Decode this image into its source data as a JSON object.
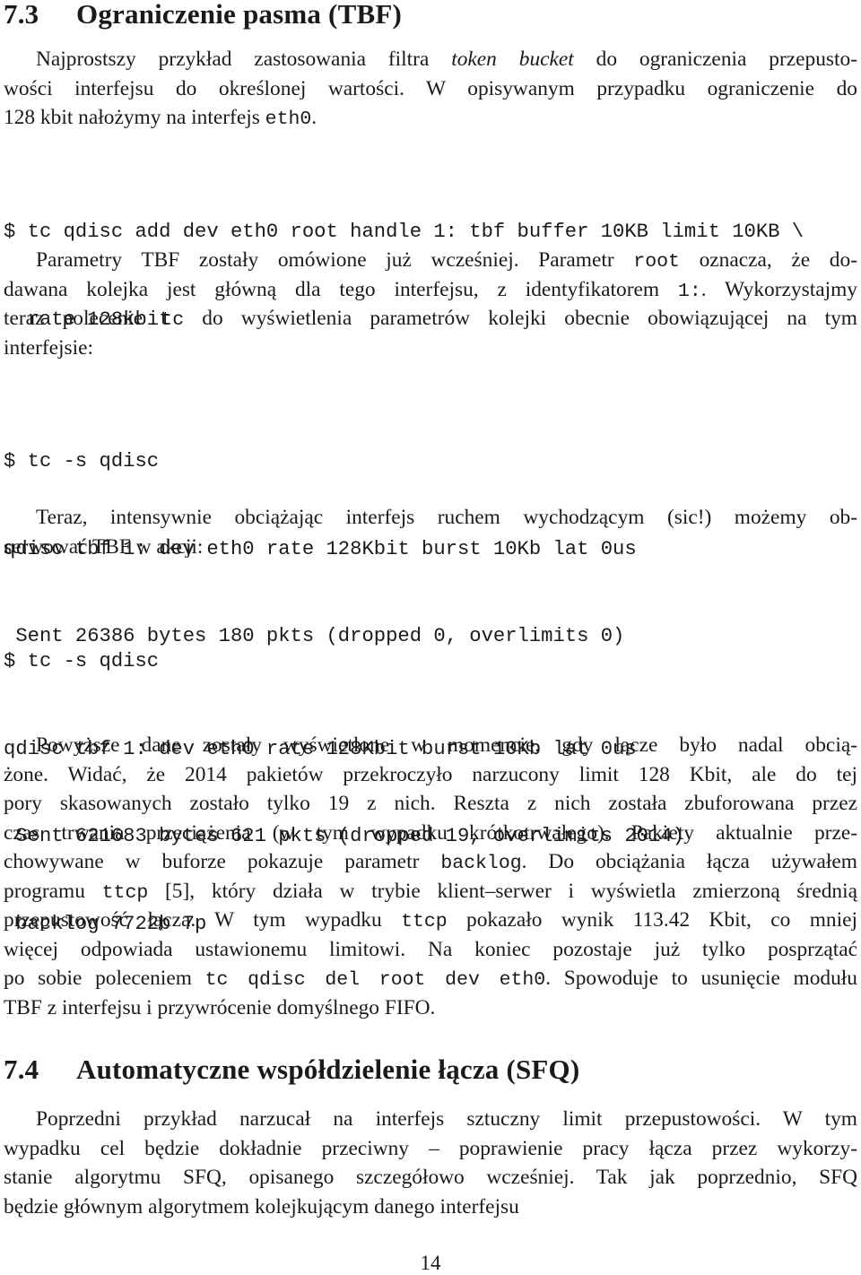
{
  "section_73": {
    "number": "7.3",
    "title": "Ograniczenie pasma (TBF)"
  },
  "p1": {
    "l1_a": "Najprostszy przykład zastosowania filtra ",
    "l1_em": "token bucket",
    "l1_b": " do ograniczenia przepusto-",
    "l2": "wości interfejsu do określonej wartości. W opisywanym przypadku ograniczenie do",
    "l3_a": "128 kbit nałożymy na interfejs ",
    "l3_code": "eth0",
    "l3_b": "."
  },
  "code1": {
    "lines": [
      "$ tc qdisc add dev eth0 root handle 1: tbf buffer 10KB limit 10KB \\",
      "  rate 128kbit"
    ]
  },
  "p2": {
    "l1_a": "Parametry TBF zostały omówione już wcześniej. Parametr ",
    "l1_code": "root",
    "l1_b": " oznacza, że do-",
    "l2_a": "dawana kolejka jest główną dla tego interfejsu, z identyfikatorem ",
    "l2_code": "1:",
    "l2_b": ". Wykorzystajmy",
    "l3_a": "teraz polecenie ",
    "l3_code": "tc",
    "l3_b": " do wyświetlenia parametrów kolejki obecnie obowiązującej na tym",
    "l4": "interfejsie:"
  },
  "code2": {
    "lines": [
      "$ tc -s qdisc",
      "qdisc tbf 1: dev eth0 rate 128Kbit burst 10Kb lat 0us",
      " Sent 26386 bytes 180 pkts (dropped 0, overlimits 0)"
    ]
  },
  "p3": {
    "l1": "Teraz, intensywnie obciążając interfejs ruchem wychodzącym (sic!) możemy ob-",
    "l2": "serwować TBF w akcji:"
  },
  "code3": {
    "lines": [
      "$ tc -s qdisc",
      "qdisc tbf 1: dev eth0 rate 128Kbit burst 10Kb lat 0us",
      " Sent 621683 bytes 621 pkts (dropped 19, overlimits 2014)",
      " backlog 7722b 7p"
    ]
  },
  "p4": {
    "l1": "Powyższe dane zostały wyświetlone w momencie, gdy łącze było nadal obcią-",
    "l2": "żone. Widać, że 2014 pakietów przekroczyło narzucony limit 128 Kbit, ale do tej",
    "l3": "pory skasowanych zostało tylko 19 z nich. Reszta z nich została zbuforowana przez",
    "l4": "czas trwania przeciążenia (w tym wypadku krótkotrwałego). Pakiety aktualnie prze-",
    "l5_a": "chowywane w buforze pokazuje parametr ",
    "l5_code": "backlog",
    "l5_b": ". Do obciążania łącza używałem",
    "l6_a": "programu ",
    "l6_code": "ttcp",
    "l6_b": " [5], który działa w trybie klient–serwer i wyświetla zmierzoną średnią",
    "l7_a": "przepustowość łącza. W tym wypadku ",
    "l7_code": "ttcp",
    "l7_b": " pokazało wynik 113.42 Kbit, co mniej",
    "l8": "więcej odpowiada ustawionemu limitowi. Na koniec pozostaje już tylko posprzątać",
    "l9_a": "po sobie poleceniem ",
    "l9_code": "tc qdisc del root dev eth0",
    "l9_b": ". Spowoduje to usunięcie modułu",
    "l10": "TBF z interfejsu i przywrócenie domyślnego FIFO."
  },
  "section_74": {
    "number": "7.4",
    "title": "Automatyczne współdzielenie łącza (SFQ)"
  },
  "p5": {
    "l1": "Poprzedni przykład narzucał na interfejs sztuczny limit przepustowości. W tym",
    "l2": "wypadku cel będzie dokładnie przeciwny – poprawienie pracy łącza przez wykorzy-",
    "l3": "stanie algorytmu SFQ, opisanego szczegółowo wcześniej. Tak jak poprzednio, SFQ",
    "l4": "będzie głównym algorytmem kolejkującym danego interfejsu"
  },
  "footer": {
    "page_number": "14"
  }
}
